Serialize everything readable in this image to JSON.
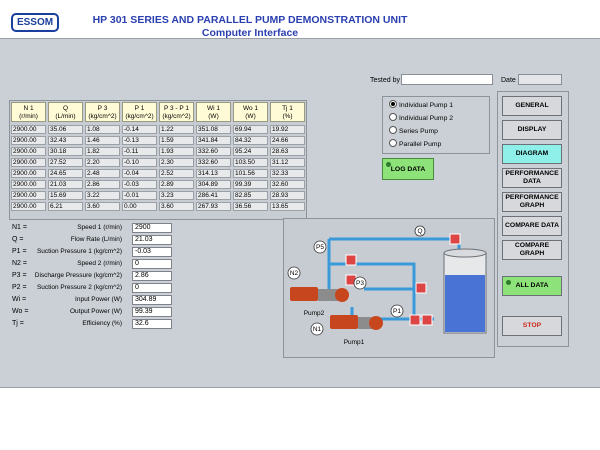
{
  "header": {
    "logo": "ESSOM",
    "title_line1": "HP 301  SERIES AND PARALLEL PUMP DEMONSTRATION UNIT",
    "title_line2": "Computer Interface",
    "tested_by_label": "Tested by",
    "tested_by_value": "",
    "date_label": "Date",
    "date_value": ""
  },
  "table": {
    "headers": [
      [
        "N 1",
        "(r/min)"
      ],
      [
        "Q",
        "(L/min)"
      ],
      [
        "P 3",
        "(kg/cm^2)"
      ],
      [
        "P 1",
        "(kg/cm^2)"
      ],
      [
        "P 3 - P 1",
        "(kg/cm^2)"
      ],
      [
        "Wi 1",
        "(W)"
      ],
      [
        "Wo 1",
        "(W)"
      ],
      [
        "Tj 1",
        "(%)"
      ]
    ],
    "rows": [
      [
        "2900.00",
        "35.06",
        "1.08",
        "-0.14",
        "1.22",
        "351.08",
        "69.94",
        "19.92"
      ],
      [
        "2900.00",
        "32.43",
        "1.46",
        "-0.13",
        "1.59",
        "341.84",
        "84.32",
        "24.66"
      ],
      [
        "2900.00",
        "30.18",
        "1.82",
        "-0.11",
        "1.93",
        "332.60",
        "95.24",
        "28.63"
      ],
      [
        "2900.00",
        "27.52",
        "2.20",
        "-0.10",
        "2.30",
        "332.60",
        "103.50",
        "31.12"
      ],
      [
        "2900.00",
        "24.65",
        "2.48",
        "-0.04",
        "2.52",
        "314.13",
        "101.56",
        "32.33"
      ],
      [
        "2900.00",
        "21.03",
        "2.86",
        "-0.03",
        "2.89",
        "304.89",
        "99.39",
        "32.60"
      ],
      [
        "2900.00",
        "15.69",
        "3.22",
        "-0.01",
        "3.23",
        "286.41",
        "82.85",
        "28.93"
      ],
      [
        "2900.00",
        "6.21",
        "3.60",
        "0.00",
        "3.60",
        "267.93",
        "36.56",
        "13.65"
      ]
    ]
  },
  "params": [
    {
      "sym": "N1 =",
      "desc": "Speed 1 (r/min)",
      "value": "2900"
    },
    {
      "sym": "Q =",
      "desc": "Flow Rate (L/min)",
      "value": "21.03"
    },
    {
      "sym": "P1 =",
      "desc": "Suction Pressure 1 (kg/cm^2)",
      "value": "-0.03"
    },
    {
      "sym": "N2 =",
      "desc": "Speed 2 (r/min)",
      "value": "0"
    },
    {
      "sym": "P3 =",
      "desc": "Discharge Pressure (kg/cm^2)",
      "value": "2.86"
    },
    {
      "sym": "P2 =",
      "desc": "Suction Pressure 2 (kg/cm^2)",
      "value": "0"
    },
    {
      "sym": "Wi =",
      "desc": "Input Power (W)",
      "value": "304.89"
    },
    {
      "sym": "Wo =",
      "desc": "Output Power (W)",
      "value": "99.39"
    },
    {
      "sym": "Tj =",
      "desc": "Efficiency (%)",
      "value": "32.6"
    }
  ],
  "modes": {
    "options": [
      "Individual Pump 1",
      "Individual Pump 2",
      "Series Pump",
      "Parallel Pump"
    ],
    "selected": "Individual Pump 1"
  },
  "log_button": "LOG DATA",
  "diagram_labels": {
    "q": "Q",
    "p5": "P5",
    "n2": "N2",
    "p3": "P3",
    "p1": "P1",
    "n1": "N1",
    "pump2": "Pump2",
    "pump1": "Pump1"
  },
  "nav": {
    "general": "GENERAL",
    "display": "DISPLAY",
    "diagram": "DIAGRAM",
    "perf_data_1": "PERFORMANCE",
    "perf_data_2": "DATA",
    "perf_graph_1": "PERFORMANCE",
    "perf_graph_2": "GRAPH",
    "compare_data": "COMPARE DATA",
    "compare_graph": "COMPARE GRAPH",
    "all_data": "ALL DATA",
    "stop": "STOP",
    "active": "DIAGRAM"
  },
  "colors": {
    "title": "#2a3fb0",
    "active_tab": "#8ff0ea",
    "green_button": "#8ee27a",
    "stop_text": "#cc2a1e",
    "pipe": "#3a9ad9",
    "pump": "#c8461e",
    "tank": "#4a73d6"
  }
}
